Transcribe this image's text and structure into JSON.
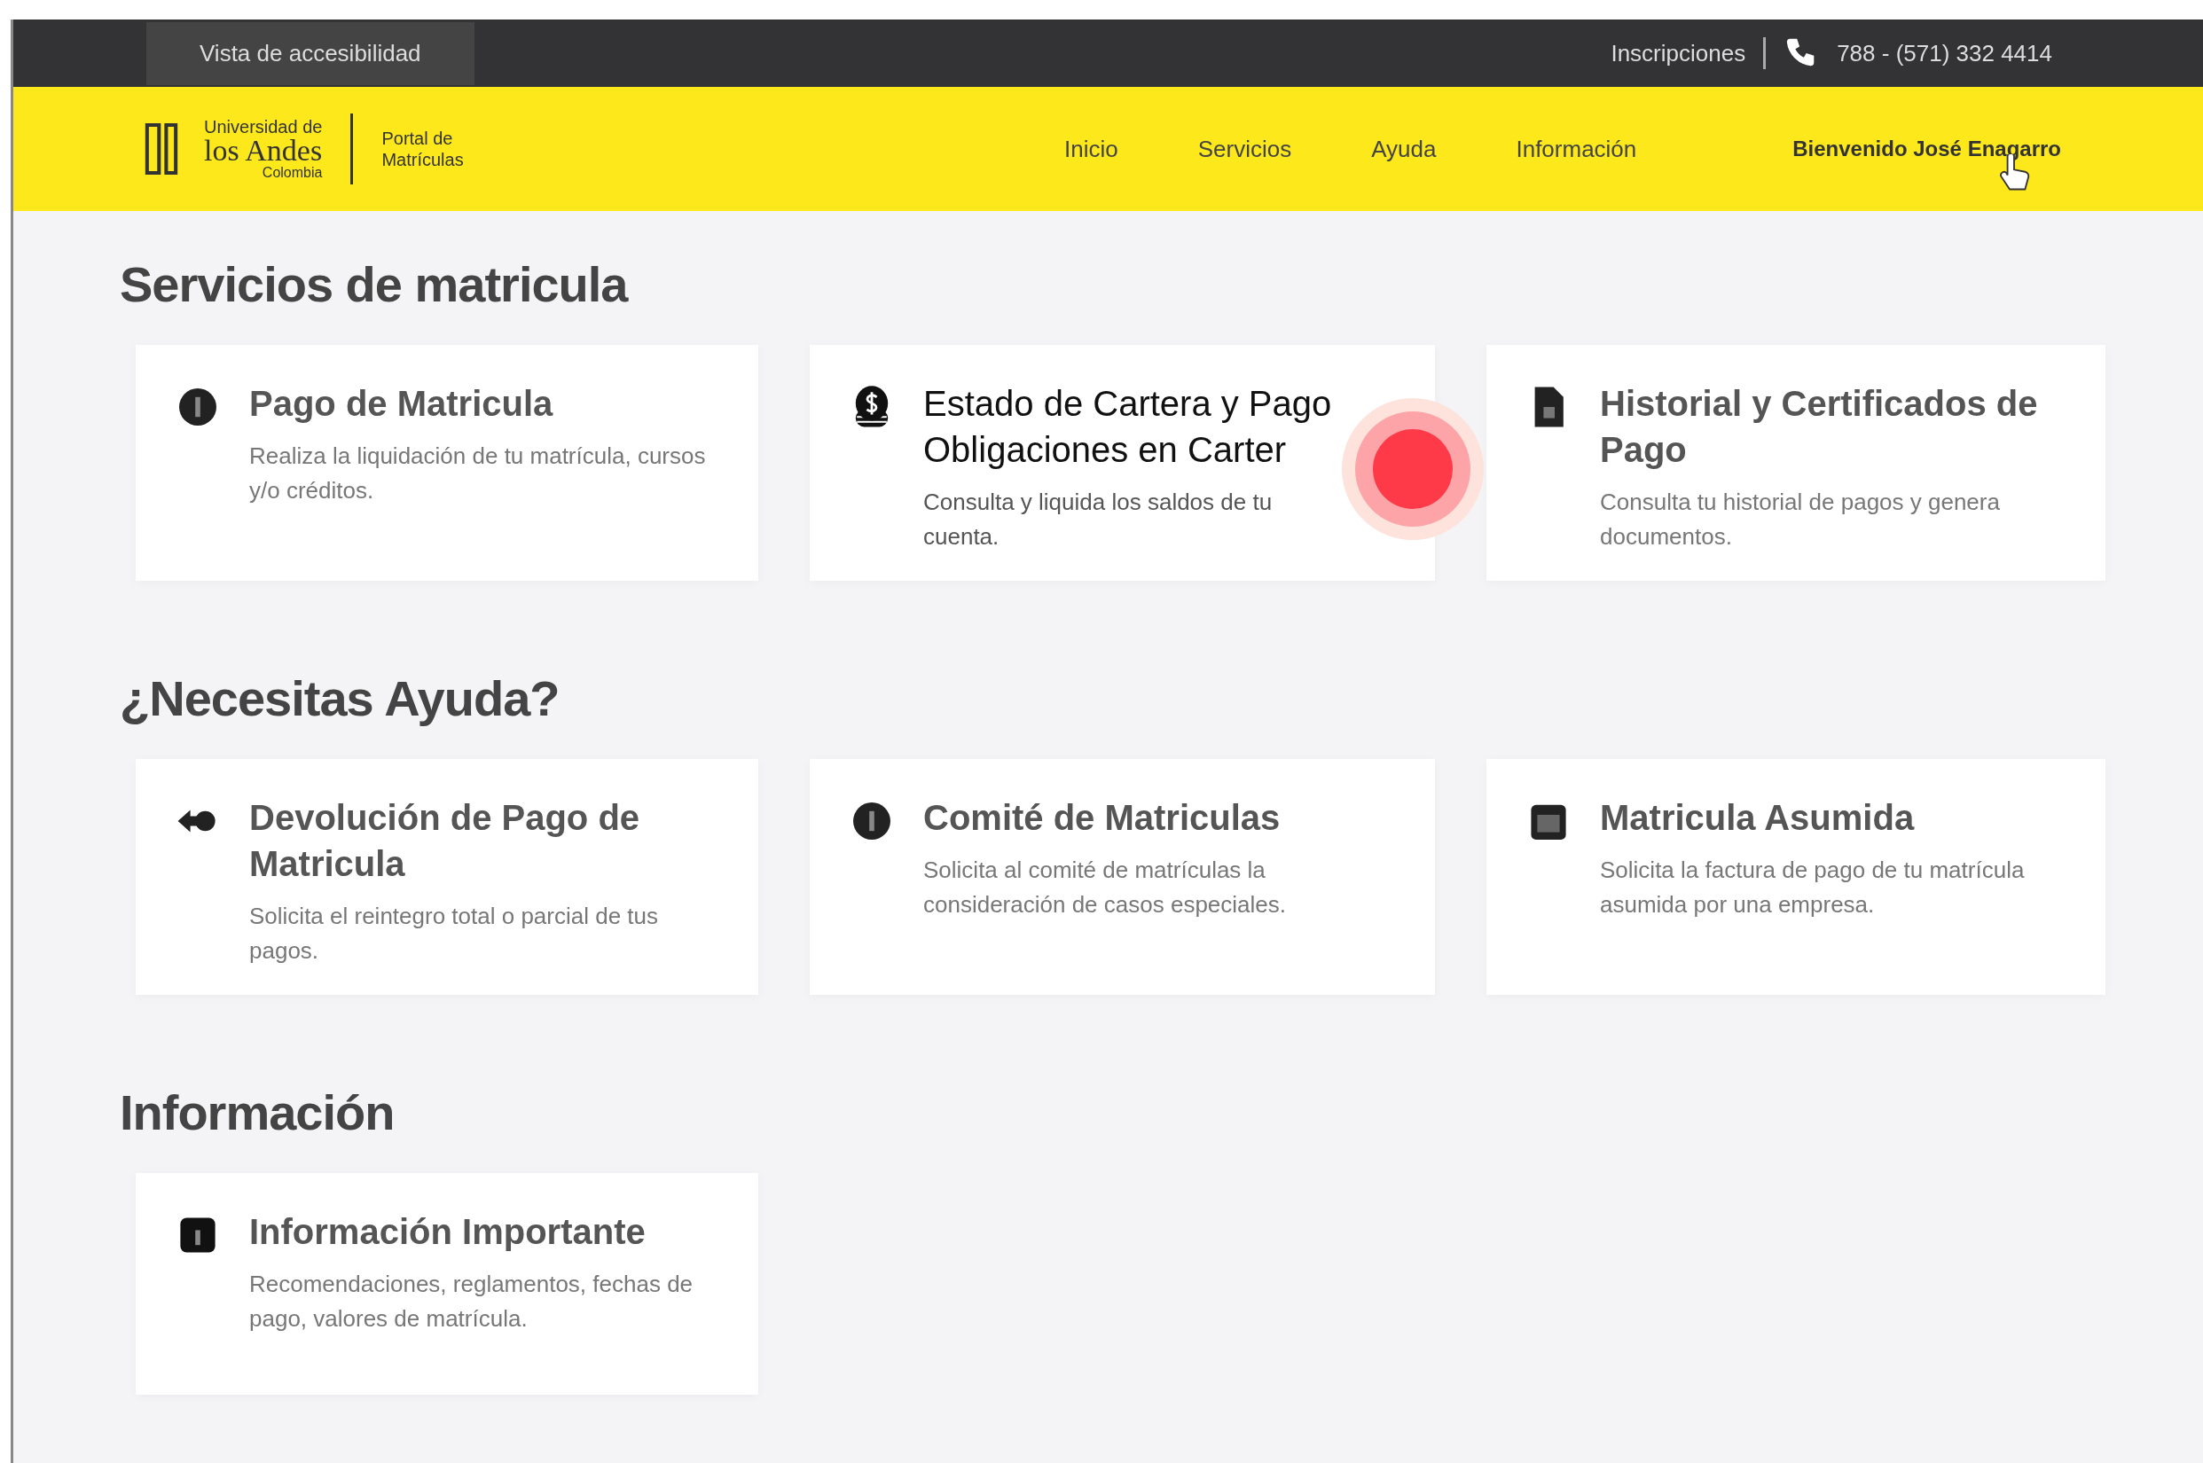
{
  "top_bar": {
    "left_link": "Vista de accesibilidad",
    "right_link": "Inscripciones",
    "phone": "788 - (571) 332 4414"
  },
  "header": {
    "logo": {
      "line_1": "Universidad de",
      "line_2": "los Andes",
      "line_3": "Colombia",
      "portal": "Portal de Matrículas"
    },
    "nav": [
      "Inicio",
      "Servicios",
      "Ayuda",
      "Información"
    ],
    "user": "Bienvenido José Enagarro"
  },
  "sections": [
    {
      "title": "Servicios de matricula",
      "cards": [
        {
          "kind": "coin",
          "title": "Pago de Matricula",
          "description": "Realiza la liquidación de tu matrícula, cursos y/o créditos.",
          "highlighted": false
        },
        {
          "kind": "coins",
          "title": "Estado de Cartera y Pago Obligaciones en Carter",
          "description": "Consulta y liquida los saldos de tu cuenta.",
          "highlighted": true,
          "tap": true
        },
        {
          "kind": "file",
          "title": "Historial y Certificados de Pago",
          "description": "Consulta tu historial de pagos y genera documentos.",
          "highlighted": false
        }
      ]
    },
    {
      "title": "¿Necesitas Ayuda?",
      "cards": [
        {
          "kind": "arrow",
          "title": "Devolución de Pago de Matricula",
          "description": "Solicita el reintegro total o parcial de tus pagos.",
          "highlighted": false
        },
        {
          "kind": "coin",
          "title": "Comité de Matriculas",
          "description": "Solicita al comité de matrículas la consideración de casos especiales.",
          "highlighted": false
        },
        {
          "kind": "calendar",
          "title": "Matricula Asumida",
          "description": "Solicita la factura de pago de tu matrícula asumida por una empresa.",
          "highlighted": false
        }
      ]
    },
    {
      "title": "Información",
      "cards": [
        {
          "kind": "info",
          "title": "Información Importante",
          "description": "Recomendaciones, reglamentos, fechas de pago, valores de matrícula.",
          "highlighted": false
        }
      ]
    }
  ]
}
